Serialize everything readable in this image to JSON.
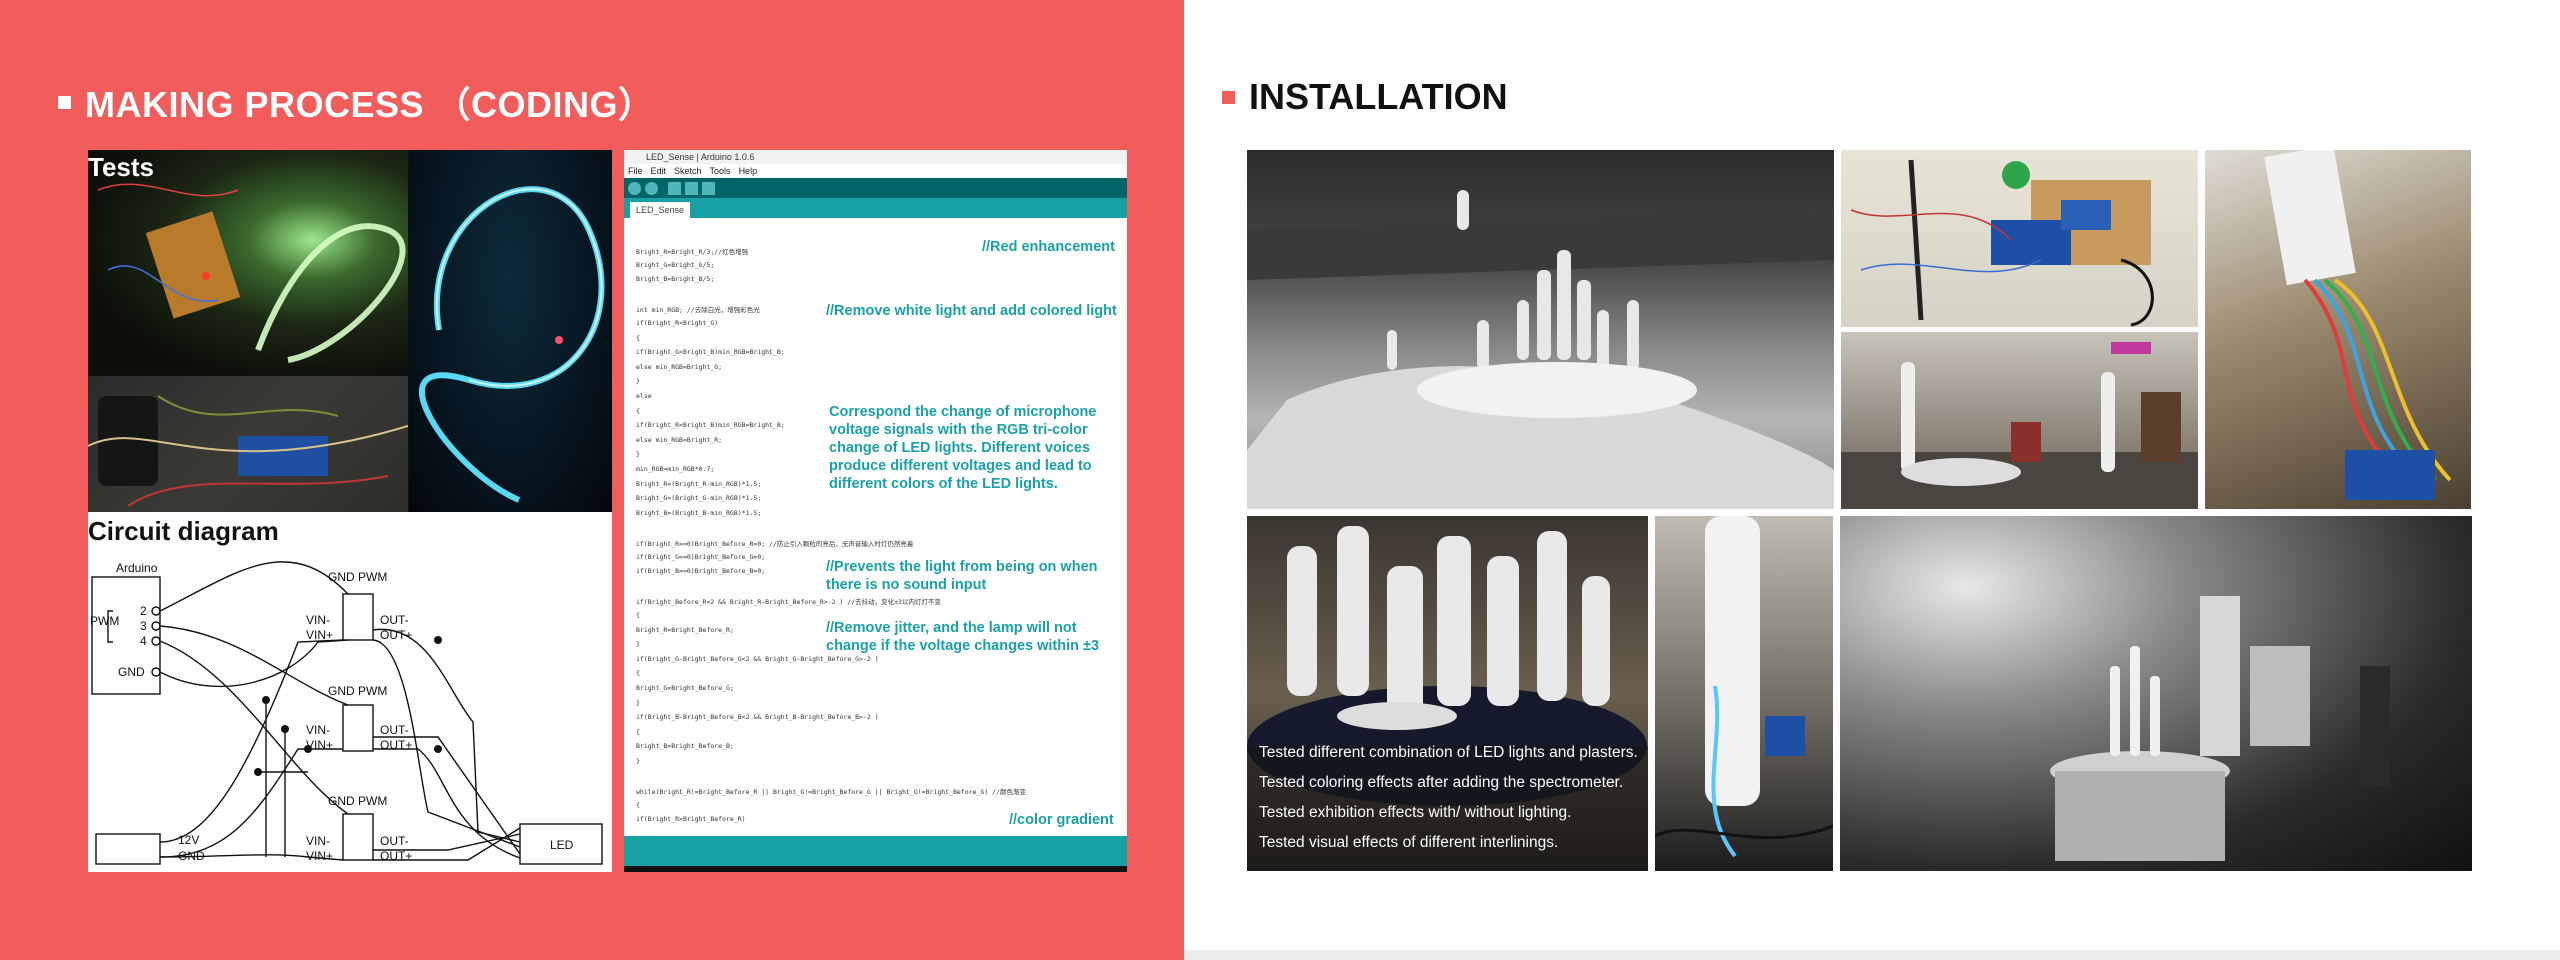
{
  "left": {
    "title": "MAKING PROCESS （CODING）",
    "tests_label": "Tests",
    "circuit_label": "Circuit diagram",
    "circuit": {
      "arduino": "Arduino",
      "pwm": "PWM",
      "pin2": "2",
      "pin3": "3",
      "pin4": "4",
      "gnd": "GND",
      "gnd_pwm": "GND PWM",
      "vin_minus": "VIN-",
      "vin_plus": "VIN+",
      "out_minus": "OUT-",
      "out_plus": "OUT+",
      "v12": "12V",
      "led": "LED"
    },
    "ide": {
      "window_title": "LED_Sense | Arduino 1.0.6",
      "menu": [
        "File",
        "Edit",
        "Sketch",
        "Tools",
        "Help"
      ],
      "tab": "LED_Sense",
      "code_lines": [
        "Bright_R=Bright_R/3;//红色增强",
        "Bright_G=Bright_G/5;",
        "Bright_B=Bright_B/5;",
        "",
        "int min_RGB; //去除白光，增强彩色光",
        "if(Bright_R<Bright_G)",
        "{",
        "  if(Bright_G<Bright_B)min_RGB=Bright_B;",
        "  else min_RGB=Bright_G;",
        "}",
        "else",
        "{",
        "  if(Bright_R<Bright_B)min_RGB=Bright_B;",
        "  else min_RGB=Bright_R;",
        "}",
        "min_RGB=min_RGB*0.7;",
        "Bright_R=(Bright_R-min_RGB)*1.5;",
        "Bright_G=(Bright_G-min_RGB)*1.5;",
        "Bright_B=(Bright_B-min_RGB)*1.5;",
        "",
        "if(Bright_R==0)Bright_Before_R=0;  //防止引入颗粒的亮后，无声音输入时灯仍然亮着",
        "if(Bright_G==0)Bright_Before_G=0;",
        "if(Bright_B==0)Bright_Before_B=0;",
        "",
        "if(Bright_Before_R<2 && Bright_R-Bright_Before_R>-2  )  //去抖动，变化±3以内灯灯不变",
        "{",
        "   Bright_R=Bright_Before_R;",
        "}",
        "if(Bright_G-Bright_Before_G<2 && Bright_G-Bright_Before_G>-2  )",
        "{",
        "   Bright_G=Bright_Before_G;",
        "}",
        "if(Bright_B-Bright_Before_B<2 && Bright_B-Bright_Before_B>-2  )",
        "{",
        "   Bright_B=Bright_Before_B;",
        "}",
        "",
        "while(Bright_R!=Bright_Before_R || Bright_G!=Bright_Before_G || Bright_G!=Bright_Before_G)  //颜色渐变",
        "{",
        "   if(Bright_R>Bright_Before_R)"
      ]
    },
    "notes": {
      "red_enhancement": "//Red enhancement",
      "remove_white": "//Remove white light and add colored light",
      "correspond": "Correspond the change of microphone voltage signals with the RGB tri-color change of LED lights. Different voices produce different voltages and lead to different colors of the LED lights.",
      "prevents": "//Prevents the light from being on when there is no sound input",
      "remove_jitter": "//Remove jitter, and the lamp will not change if the voltage changes within ±3",
      "color_gradient": "//color gradient"
    },
    "colors": {
      "background": "#f25c5a",
      "accent": "#1aa1a5",
      "ide_dark": "#006468"
    }
  },
  "right": {
    "title": "INSTALLATION",
    "captions": [
      "Tested different combination of LED lights and plasters.",
      "Tested coloring effects after adding the spectrometer.",
      "Tested exhibition effects with/ without lighting.",
      "Tested visual effects of different interlinings."
    ]
  }
}
